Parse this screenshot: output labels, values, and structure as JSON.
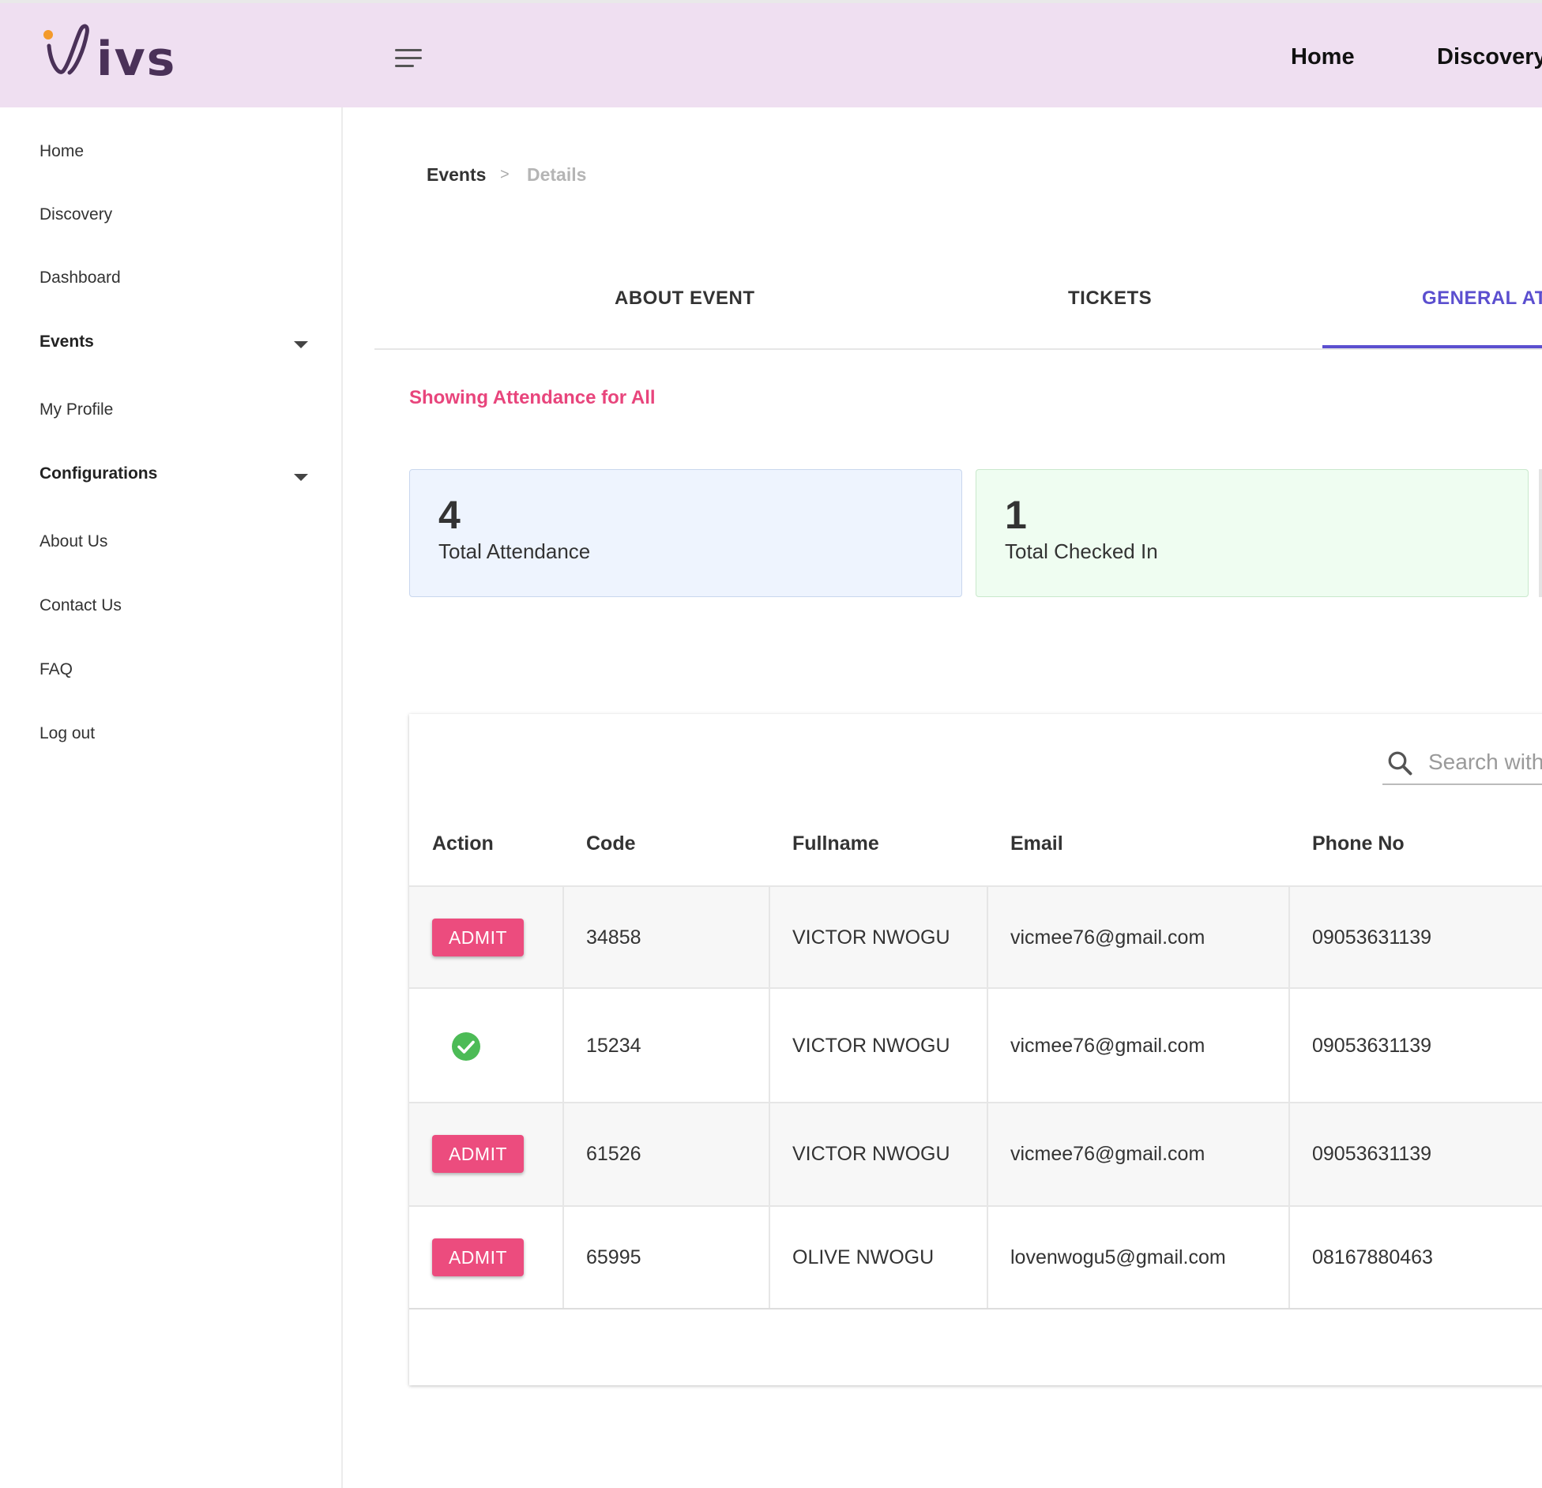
{
  "app": {
    "logo_text": "ivs",
    "nav": {
      "home": "Home",
      "discovery": "Discovery"
    }
  },
  "sidebar": {
    "items": [
      {
        "label": "Home"
      },
      {
        "label": "Discovery"
      },
      {
        "label": "Dashboard"
      },
      {
        "label": "Events"
      },
      {
        "label": "My Profile"
      },
      {
        "label": "Configurations"
      },
      {
        "label": "About Us"
      },
      {
        "label": "Contact Us"
      },
      {
        "label": "FAQ"
      },
      {
        "label": "Log out"
      }
    ]
  },
  "breadcrumb": {
    "parent": "Events",
    "separator": ">",
    "current": "Details"
  },
  "tabs": [
    {
      "label": "ABOUT EVENT"
    },
    {
      "label": "TICKETS"
    },
    {
      "label": "GENERAL AT"
    }
  ],
  "attendance": {
    "heading": "Showing Attendance for All",
    "stats": [
      {
        "value": "4",
        "label": "Total Attendance"
      },
      {
        "value": "1",
        "label": "Total Checked In"
      }
    ]
  },
  "table": {
    "search_placeholder": "Search with",
    "columns": [
      "Action",
      "Code",
      "Fullname",
      "Email",
      "Phone No"
    ],
    "action_label": "ADMIT",
    "rows": [
      {
        "status": "admit",
        "code": "34858",
        "fullname": "VICTOR NWOGU",
        "email": "vicmee76@gmail.com",
        "phone": "09053631139"
      },
      {
        "status": "checked-in",
        "code": "15234",
        "fullname": "VICTOR NWOGU",
        "email": "vicmee76@gmail.com",
        "phone": "09053631139"
      },
      {
        "status": "admit",
        "code": "61526",
        "fullname": "VICTOR NWOGU",
        "email": "vicmee76@gmail.com",
        "phone": "09053631139"
      },
      {
        "status": "admit",
        "code": "65995",
        "fullname": "OLIVE NWOGU",
        "email": "lovenwogu5@gmail.com",
        "phone": "08167880463"
      }
    ]
  },
  "colors": {
    "header_bg": "#efdff1",
    "accent": "#5b4fcf",
    "pink": "#ec4c7e",
    "success": "#4cbb56",
    "card_blue": "#eef4fe",
    "card_green": "#effdf1"
  }
}
